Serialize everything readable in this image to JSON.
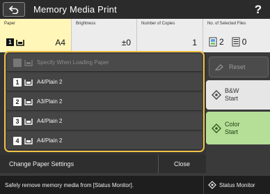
{
  "header": {
    "title": "Memory Media Print",
    "help_label": "?"
  },
  "info": {
    "paper": {
      "label": "Paper",
      "value": "A4",
      "tray": "1"
    },
    "brightness": {
      "label": "Brightness",
      "value": "±0"
    },
    "copies": {
      "label": "Number of Copies",
      "value": "1"
    },
    "files": {
      "label": "No. of Selected Files",
      "count_a": "2",
      "count_b": "0"
    }
  },
  "paper_menu": {
    "header_item": "Specify When Loading Paper",
    "items": [
      {
        "num": "1",
        "label": "A4/Plain 2"
      },
      {
        "num": "2",
        "label": "A3/Plain 2"
      },
      {
        "num": "3",
        "label": "A4/Plain 2"
      },
      {
        "num": "4",
        "label": "A4/Plain 2"
      }
    ]
  },
  "bottom": {
    "change_paper": "Change Paper Settings",
    "close": "Close"
  },
  "right": {
    "reset": "Reset",
    "bw_start": [
      "B&W",
      "Start"
    ],
    "color_start": [
      "Color",
      "Start"
    ]
  },
  "status": {
    "message": "Safely remove memory media from [Status Monitor].",
    "monitor": "Status Monitor"
  },
  "colors": {
    "accent": "#f1c049",
    "color_start_bg": "#b5df97",
    "paper_cell_bg": "#fff6b8"
  }
}
